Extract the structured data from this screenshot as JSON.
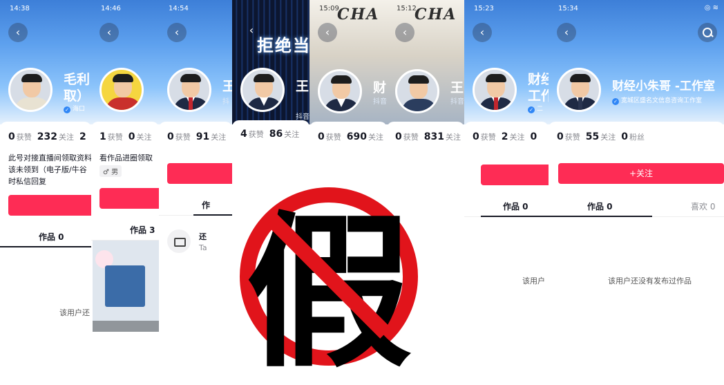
{
  "strips": [
    {
      "time": "14:38",
      "name": "毛利",
      "name_line2": "取）",
      "verify_text": "海口",
      "stats": [
        {
          "n": "0",
          "l": "获赞"
        },
        {
          "n": "232",
          "l": "关注"
        },
        {
          "n": "2",
          "l": ""
        }
      ],
      "bio": "此号对接直播间领取资料\n该未领到（电子版/牛谷\n时私信回复",
      "tab": "作品 0",
      "empty": "该用户还"
    },
    {
      "time": "14:46",
      "stats": [
        {
          "n": "1",
          "l": "获赞"
        },
        {
          "n": "0",
          "l": "关注"
        }
      ],
      "bio": "看作品进圈领取",
      "gender": "♂ 男",
      "tab": "作品 3"
    },
    {
      "time": "14:54",
      "name": "王",
      "sub": "抖",
      "stats": [
        {
          "n": "0",
          "l": "获赞"
        },
        {
          "n": "91",
          "l": "关注"
        }
      ],
      "tab": "作",
      "empty_title": "还",
      "empty_sub": "Ta"
    },
    {
      "time": "",
      "banner_title": "拒绝当",
      "name": "王",
      "sub": "抖音",
      "stats": [
        {
          "n": "4",
          "l": "获赞"
        },
        {
          "n": "86",
          "l": "关注"
        }
      ]
    },
    {
      "time": "15:09",
      "name": "财",
      "sub": "抖音",
      "stats": [
        {
          "n": "0",
          "l": "获赞"
        },
        {
          "n": "690",
          "l": "关注"
        }
      ]
    },
    {
      "time": "15:12",
      "name": "王",
      "sub": "抖音",
      "stats": [
        {
          "n": "0",
          "l": "获赞"
        },
        {
          "n": "831",
          "l": "关注"
        }
      ]
    },
    {
      "time": "15:23",
      "name": "财经",
      "name_line2": "工作",
      "verify_text": "二",
      "stats": [
        {
          "n": "0",
          "l": "获赞"
        },
        {
          "n": "2",
          "l": "关注"
        },
        {
          "n": "0",
          "l": ""
        }
      ],
      "tab": "作品 0",
      "empty": "该用户"
    },
    {
      "time": "15:34",
      "name": "财经小朱哥 -工作室",
      "verify_text": "宽城区盛名文信息咨询工作室",
      "stats": [
        {
          "n": "0",
          "l": "获赞"
        },
        {
          "n": "55",
          "l": "关注"
        },
        {
          "n": "0",
          "l": "粉丝"
        }
      ],
      "follow_label": "+关注",
      "tab": "作品 0",
      "tab2": "喜欢 0",
      "empty": "该用户还没有发布过作品"
    }
  ],
  "stamp": {
    "char": "假",
    "color": "#e1141b"
  },
  "cert_title": "CHA",
  "colors": {
    "follow": "#fe2c55",
    "verify": "#2f86f6"
  }
}
